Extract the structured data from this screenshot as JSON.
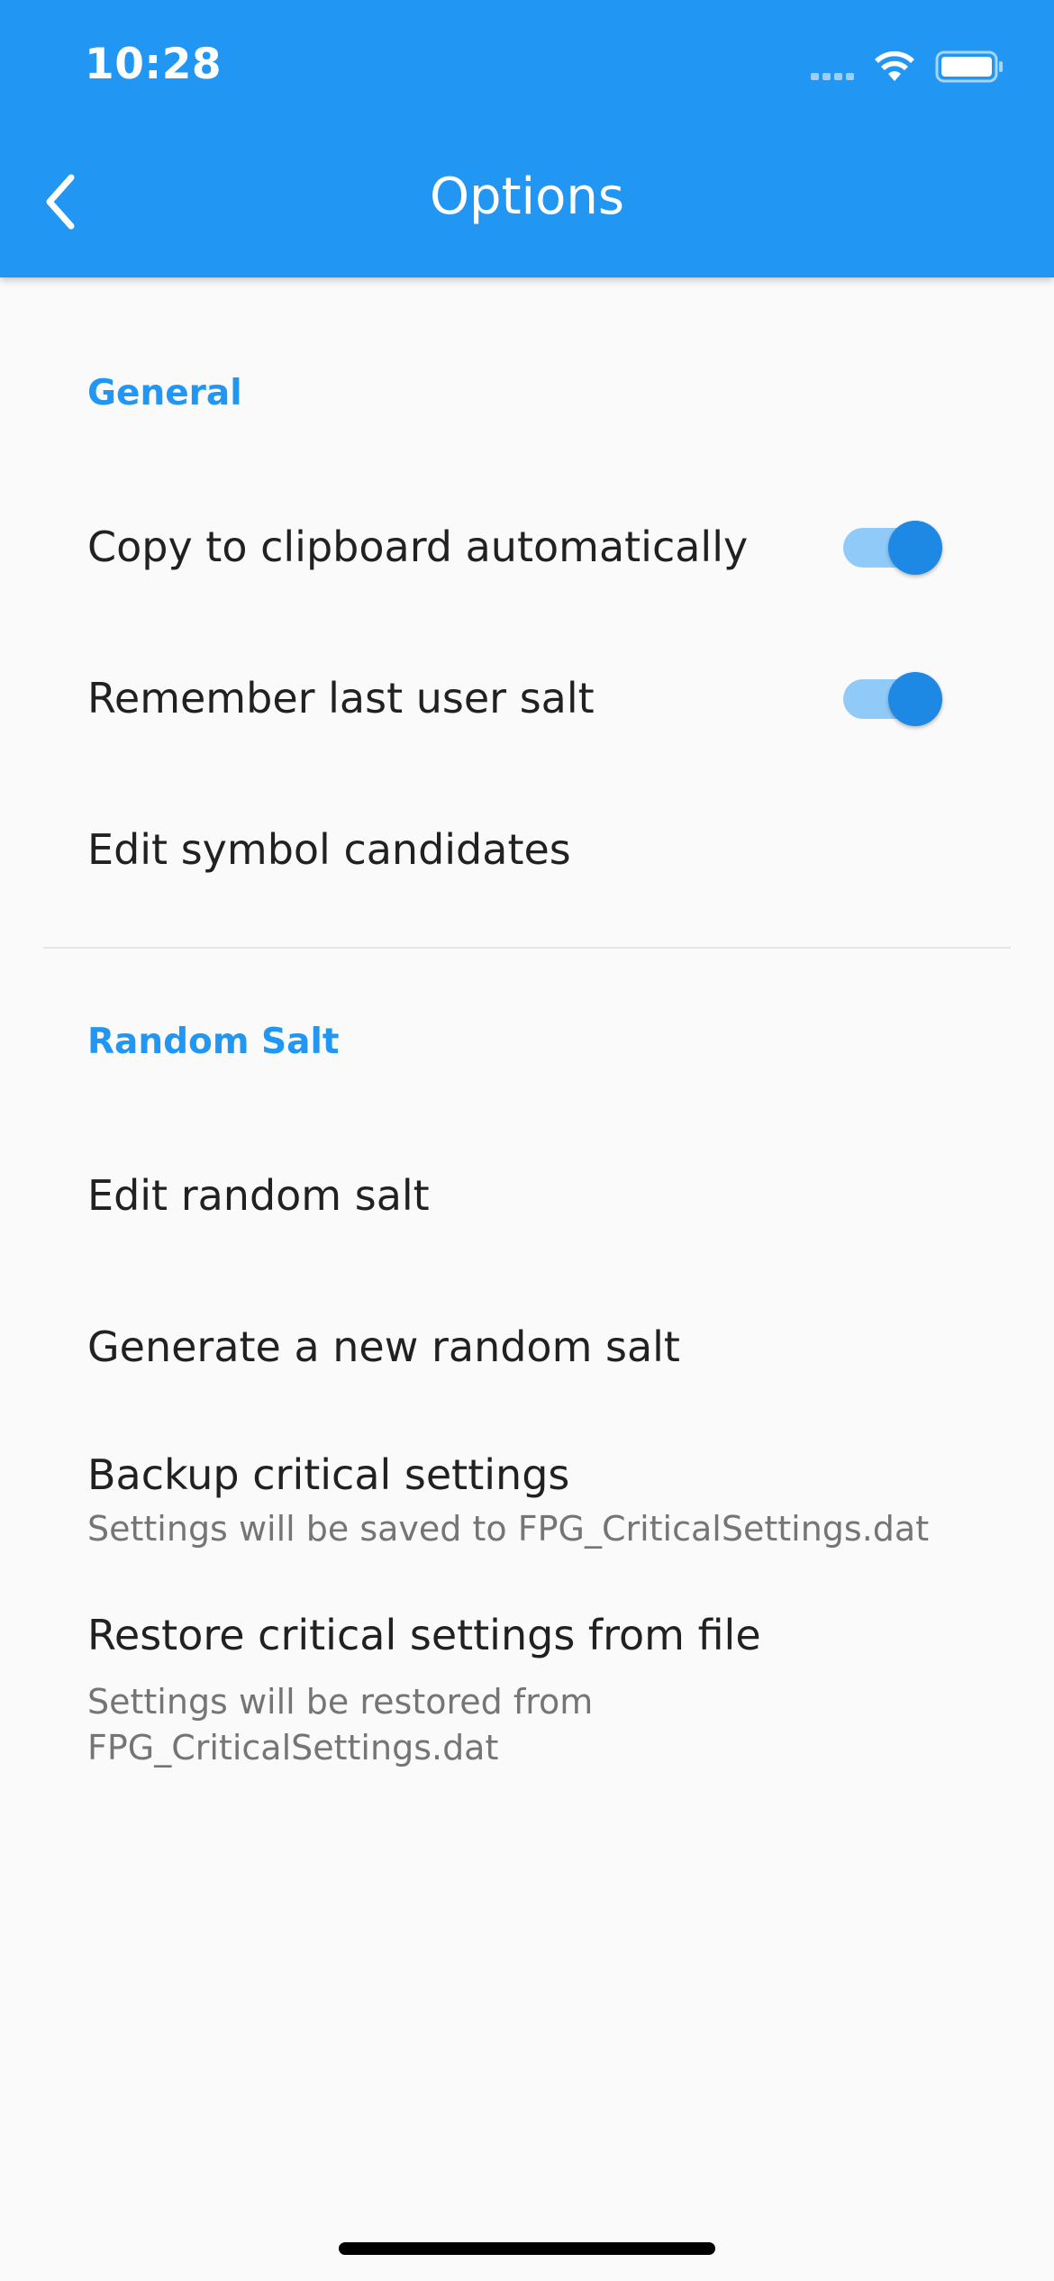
{
  "status_bar": {
    "time": "10:28",
    "icons": [
      "signal-icon",
      "wifi-icon",
      "battery-icon"
    ]
  },
  "appbar": {
    "title": "Options",
    "back_icon": "chevron-left-icon",
    "color": "#2196f3"
  },
  "sections": {
    "general": {
      "header": "General",
      "copy_clipboard": {
        "label": "Copy to clipboard automatically",
        "enabled": true
      },
      "remember_salt": {
        "label": "Remember last user salt",
        "enabled": true
      },
      "edit_symbols": {
        "label": "Edit symbol candidates"
      }
    },
    "random_salt": {
      "header": "Random Salt",
      "edit_random": {
        "label": "Edit random salt"
      },
      "generate_new": {
        "label": "Generate a new random salt"
      },
      "backup": {
        "label": "Backup critical settings",
        "subtitle": "Settings will be saved to FPG_CriticalSettings.dat"
      },
      "restore": {
        "label": "Restore critical settings from file",
        "subtitle": "Settings will be restored from FPG_CriticalSettings.dat"
      }
    }
  },
  "colors": {
    "accent": "#2196f3",
    "toggle_thumb": "#1e88e5",
    "toggle_track": "#90caf9",
    "background": "#fafafa"
  }
}
